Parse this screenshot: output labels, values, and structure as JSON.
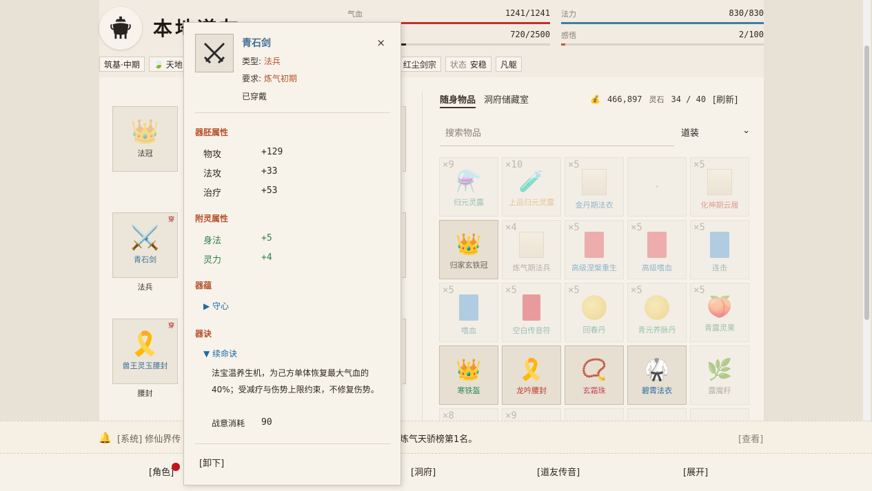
{
  "header": {
    "title": "本地道友",
    "hp": {
      "label": "气血",
      "value": "1241/1241",
      "fraction": 1.0,
      "color": "#c0312b"
    },
    "mp": {
      "label": "法力",
      "value": "830/830",
      "fraction": 1.0,
      "color": "#3a7fa3"
    },
    "exp": {
      "value": "720/2500",
      "fraction": 0.288,
      "color": "#2b2620"
    },
    "insight": {
      "label": "感悟",
      "value": "2/100",
      "fraction": 0.02,
      "color": "#c05a2b"
    },
    "tags": {
      "realm": "筑基·中期",
      "root": "天地",
      "sect": "红尘剑宗",
      "status_label": "状态",
      "status_value": "安稳",
      "body": "凡躯"
    }
  },
  "equipment": {
    "slot1": {
      "name": "法冠",
      "icon": "crown-icon"
    },
    "slot2": {
      "name": "青石剑",
      "icon": "crossed-swords-icon",
      "worn": "穿",
      "label": "法兵"
    },
    "slot3": {
      "name": "兽王灵玉腰封",
      "icon": "ribbon-icon",
      "worn": "穿",
      "label": "腰封"
    }
  },
  "inventory": {
    "tab_carry": "随身物品",
    "tab_storage": "洞府储藏室",
    "money": "466,897",
    "money_unit": "灵石",
    "capacity": "34 / 40",
    "refresh": "[刷新]",
    "search_placeholder": "搜索物品",
    "filter": "道装",
    "items": [
      {
        "count": "×9",
        "name": "归元灵露",
        "icon": "potion-icon"
      },
      {
        "count": "×10",
        "name": "上品归元灵露",
        "icon": "potion-gold-icon"
      },
      {
        "count": "×5",
        "name": "金丹期法衣",
        "icon": "scroll-icon"
      },
      {
        "count": "",
        "name": "",
        "icon": "empty"
      },
      {
        "count": "×5",
        "name": "化神期云履",
        "icon": "scroll-icon"
      },
      {
        "count": "",
        "name": "归家玄铁冠",
        "icon": "crown-icon"
      },
      {
        "count": "×4",
        "name": "炼气期法兵",
        "icon": "scroll-icon"
      },
      {
        "count": "×5",
        "name": "高级涅槃重生",
        "icon": "book-red-icon"
      },
      {
        "count": "×5",
        "name": "高级嗜血",
        "icon": "book-red-icon"
      },
      {
        "count": "×5",
        "name": "连击",
        "icon": "book-blue-icon"
      },
      {
        "count": "×5",
        "name": "嗜血",
        "icon": "book-blue-icon"
      },
      {
        "count": "×5",
        "name": "空白传音符",
        "icon": "talisman-icon"
      },
      {
        "count": "×5",
        "name": "回春丹",
        "icon": "pill-icon"
      },
      {
        "count": "×5",
        "name": "青元养脉丹",
        "icon": "pill-icon"
      },
      {
        "count": "×5",
        "name": "青露灵果",
        "icon": "peach-icon"
      },
      {
        "count": "",
        "name": "寒铁盔",
        "icon": "crown-icon"
      },
      {
        "count": "",
        "name": "龙吟腰封",
        "icon": "ribbon-icon"
      },
      {
        "count": "",
        "name": "玄霜珠",
        "icon": "beads-icon"
      },
      {
        "count": "",
        "name": "碧霄法衣",
        "icon": "robe-icon"
      },
      {
        "count": "",
        "name": "露魔籽",
        "icon": "herb-icon"
      }
    ],
    "row5_counts": [
      "×8",
      "×9"
    ]
  },
  "tooltip": {
    "name": "青石剑",
    "type_label": "类型:",
    "type_value": "法兵",
    "req_label": "要求:",
    "req_value": "炼气初期",
    "equipped": "已穿戴",
    "close": "×",
    "base_title": "器胚属性",
    "base": [
      {
        "k": "物攻",
        "v": "+129"
      },
      {
        "k": "法攻",
        "v": "+33"
      },
      {
        "k": "治疗",
        "v": "+53"
      }
    ],
    "spirit_title": "附灵属性",
    "spirit": [
      {
        "k": "身法",
        "v": "+5"
      },
      {
        "k": "灵力",
        "v": "+4"
      }
    ],
    "yun_title": "器蕴",
    "yun_item": "▶ 守心",
    "jue_title": "器诀",
    "jue_item": "▼ 续命诀",
    "jue_desc": "法宝温养生机，为己方单体恢复最大气血的40%；受减疗与伤势上限约束，不修复伤势。",
    "cost_label": "战意消耗",
    "cost_value": "90",
    "unequip": "[卸下]"
  },
  "notice": {
    "prefix": "[系统] 修仙界传",
    "message": "炼气天骄榜第1名。",
    "view": "[查看]"
  },
  "nav": {
    "role": "[角色]",
    "dongfu": "[洞府]",
    "friends": "[道友传音]",
    "expand": "[展开]"
  }
}
